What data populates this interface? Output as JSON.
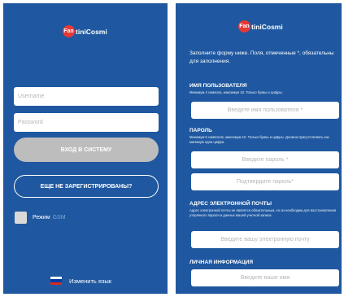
{
  "brand": {
    "badge": "Fan",
    "name": "tiniCosmi"
  },
  "login": {
    "username_placeholder": "Username",
    "password_placeholder": "Password",
    "login_button": "ВХОД В СИСТЕМУ",
    "register_button": "ЕЩЕ НЕ ЗАРЕГИСТРИРОВАНЫ?",
    "gsm_label": "Режим",
    "gsm_accent": "GSM",
    "gsm_checked": false,
    "language_link": "Изменить язык",
    "flag_colors": [
      "#ffffff",
      "#0039a6",
      "#d52b1e"
    ]
  },
  "register": {
    "intro": "Заполните форму ниже. Поля, отмеченные *, обязательны для заполнения.",
    "username": {
      "title": "ИМЯ ПОЛЬЗОВАТЕЛЯ",
      "hint": "Минимум 4 символа, максимум 10. Только буквы и цифры.",
      "placeholder": "Введите имя пользователя *"
    },
    "password": {
      "title": "ПАРОЛЬ",
      "hint": "Минимум 5 символов, максимум 10. Только буквы и цифры. Должна присутствовать как минимум одна цифра.",
      "placeholder": "Введите пароль *",
      "confirm_placeholder": "Подтвердите пароль*"
    },
    "email": {
      "title": "АДРЕС ЭЛЕКТРОННОЙ ПОЧТЫ",
      "hint": "Адрес электронной почты не является обязательным, но он необходим для восстановления утерянного пароля и данных вашей учетной записи.",
      "placeholder": "Введите вашу электронную почту"
    },
    "personal": {
      "title": "ЛИЧНАЯ ИНФОРМАЦИЯ",
      "placeholder": "Введите ваше имя"
    }
  },
  "colors": {
    "background": "#1f58a0",
    "logo_badge": "#e53935",
    "login_button": "#bdbdbd"
  }
}
